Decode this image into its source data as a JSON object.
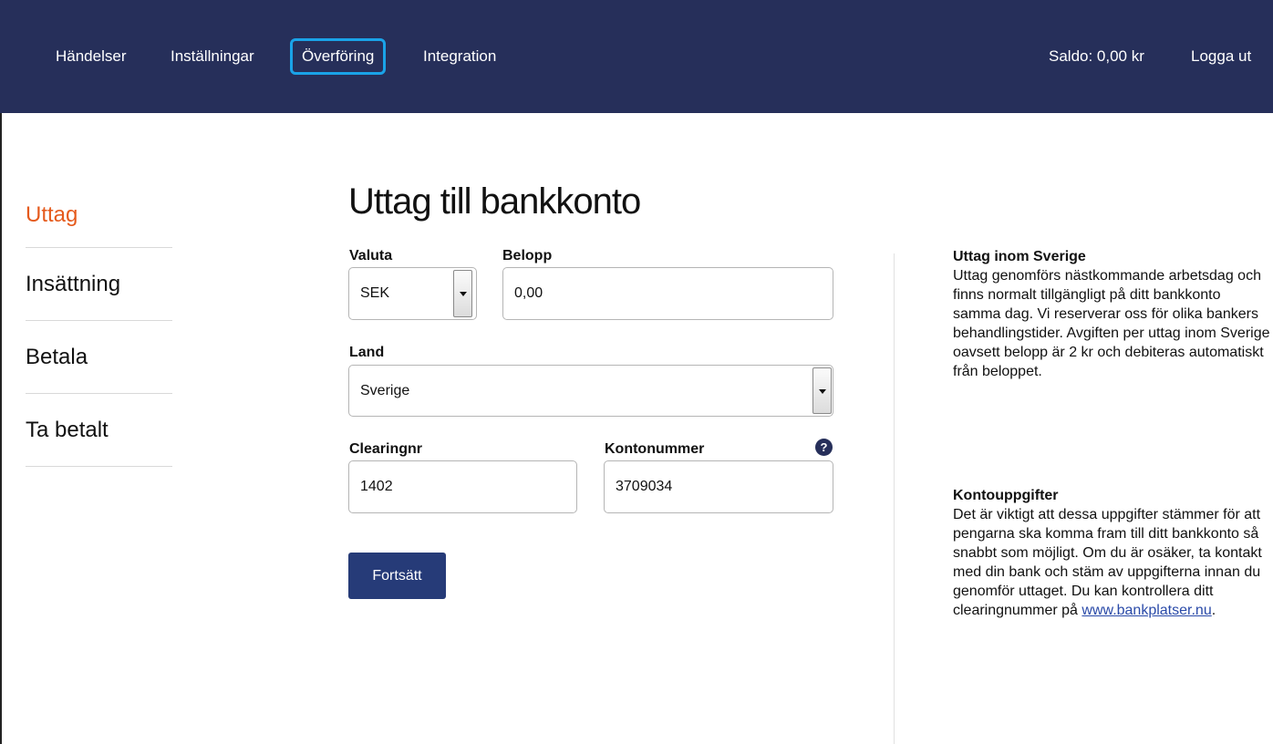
{
  "nav": {
    "items": [
      "Händelser",
      "Inställningar",
      "Överföring",
      "Integration"
    ],
    "active": "Överföring",
    "balance": "Saldo: 0,00 kr",
    "logout": "Logga ut"
  },
  "sidebar": {
    "items": [
      "Uttag",
      "Insättning",
      "Betala",
      "Ta betalt"
    ],
    "active": "Uttag",
    "active_color": "#e55a1c"
  },
  "form": {
    "title": "Uttag till bankkonto",
    "currency_label": "Valuta",
    "currency_value": "SEK",
    "amount_label": "Belopp",
    "amount_value": "0,00",
    "country_label": "Land",
    "country_value": "Sverige",
    "clearing_label": "Clearingnr",
    "clearing_value": "1402",
    "account_label": "Kontonummer",
    "account_value": "3709034",
    "help_icon": "question-circle-icon",
    "continue_label": "Fortsätt"
  },
  "info": {
    "section1_title": "Uttag inom Sverige",
    "section1_text": "Uttag genomförs nästkommande arbetsdag och finns normalt tillgängligt på ditt bankkonto samma dag. Vi reserverar oss för olika bankers behandlingstider. Avgiften per uttag inom Sverige oavsett belopp är 2 kr och debiteras automatiskt från beloppet.",
    "section2_title": "Kontouppgifter",
    "section2_text": "Det är viktigt att dessa uppgifter stämmer för att pengarna ska komma fram till ditt bankkonto så snabbt som möjligt. Om du är osäker, ta kontakt med din bank och stäm av uppgifterna innan du genomför uttaget. Du kan kontrollera ditt clearingnummer på",
    "link_text": "www.bankplatser.nu",
    "link_suffix": "."
  },
  "colors": {
    "navbar": "#262f5a",
    "active_outline": "#1aa3e8",
    "button": "#263b78",
    "link": "#2a4aa8"
  }
}
